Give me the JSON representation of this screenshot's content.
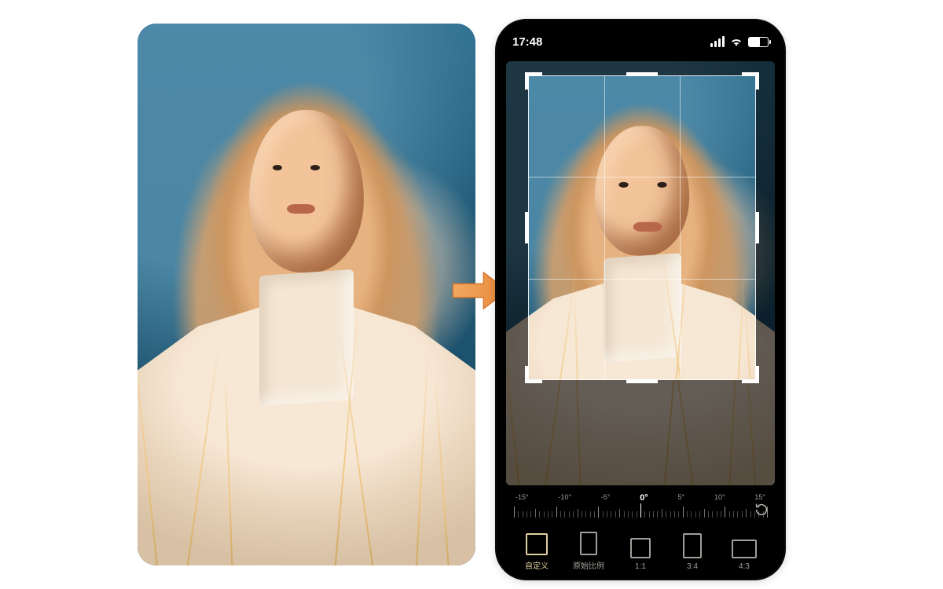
{
  "statusbar": {
    "time": "17:48"
  },
  "ruler": {
    "labels": [
      "-15°",
      "-10°",
      "-5°",
      "0°",
      "5°",
      "10°",
      "15°"
    ],
    "current_index": 3
  },
  "ratios": [
    {
      "id": "custom",
      "label": "自定义",
      "shape": "sq",
      "selected": true
    },
    {
      "id": "original",
      "label": "原始比例",
      "shape": "original",
      "selected": false
    },
    {
      "id": "r11",
      "label": "1:1",
      "shape": "r11",
      "selected": false
    },
    {
      "id": "r34",
      "label": "3:4",
      "shape": "r34",
      "selected": false
    },
    {
      "id": "r43",
      "label": "4:3",
      "shape": "r43",
      "selected": false
    }
  ]
}
